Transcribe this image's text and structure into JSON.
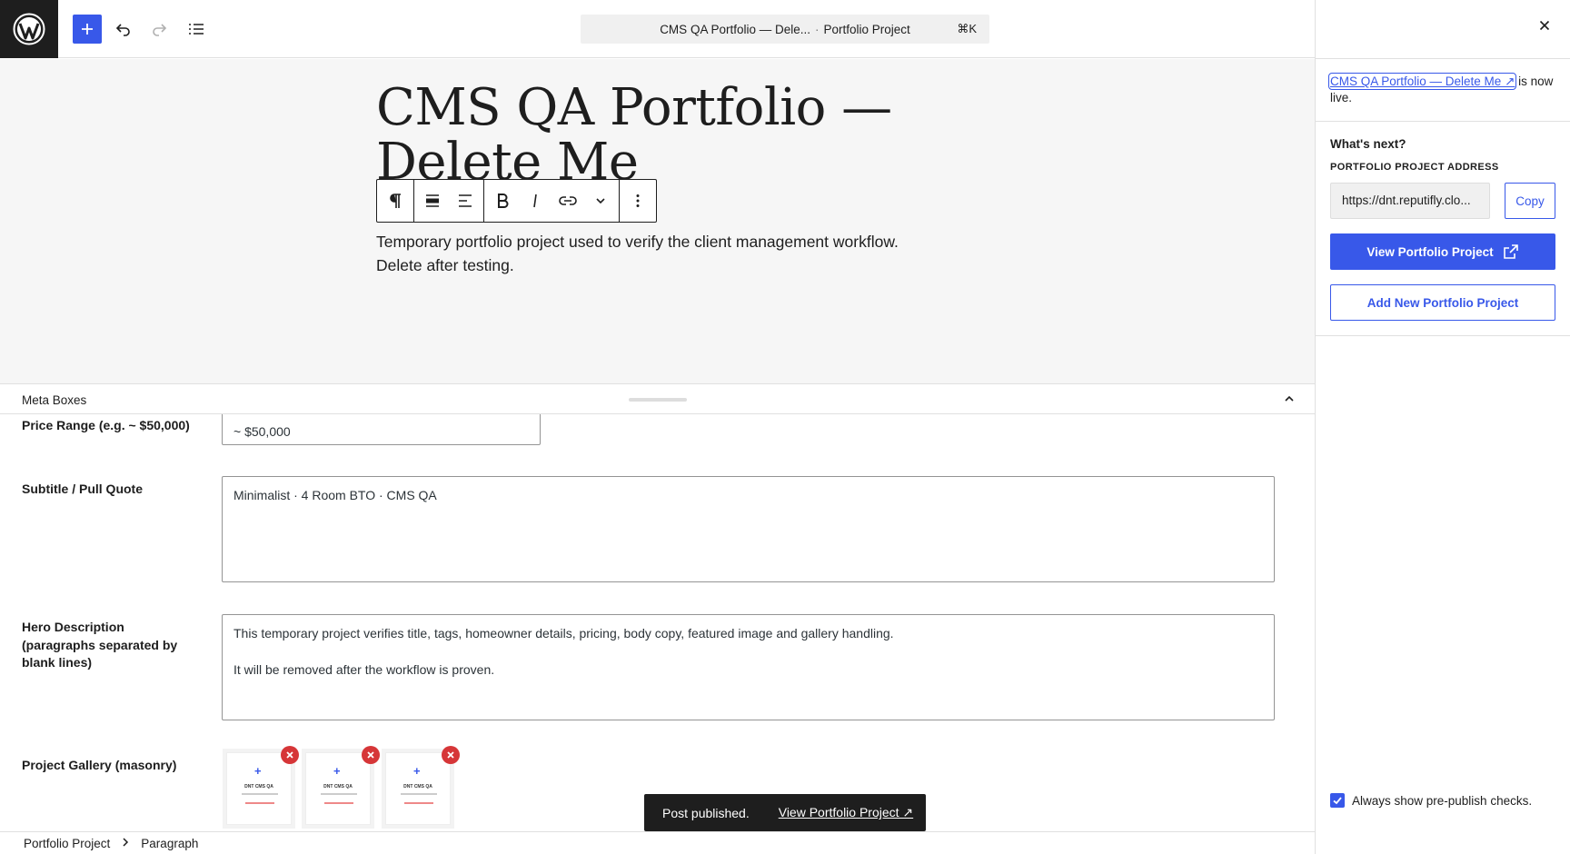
{
  "topbar": {
    "command_title": "CMS QA Portfolio — Dele...",
    "command_separator": "·",
    "command_type": "Portfolio Project",
    "shortcut": "⌘K",
    "icons": [
      "wordpress-logo",
      "plus-icon",
      "undo-icon",
      "redo-icon",
      "document-overview-icon"
    ]
  },
  "editor": {
    "title": "CMS QA Portfolio — Delete Me",
    "paragraph": "Temporary portfolio project used to verify the client management workflow. Delete after testing.",
    "block_toolbar_icons": [
      "paragraph-icon",
      "align-block-icon",
      "align-text-icon",
      "bold-icon",
      "italic-icon",
      "link-icon",
      "more-rich-text-icon",
      "options-icon"
    ]
  },
  "meta_boxes": {
    "title": "Meta Boxes",
    "price_label": "Price Range (e.g. ~ $50,000)",
    "price_value": "~ $50,000",
    "subtitle_label": "Subtitle / Pull Quote",
    "subtitle_value": "Minimalist · 4 Room BTO · CMS QA",
    "hero_label": "Hero Description (paragraphs separated by blank lines)",
    "hero_value_p1": "This temporary project verifies title, tags, homeowner details, pricing, body copy, featured image and gallery handling.",
    "hero_value_p2": "It will be removed after the workflow is proven.",
    "gallery_label": "Project Gallery (masonry)",
    "gallery_thumb_text": "DNT CMS QA"
  },
  "snackbar": {
    "message": "Post published.",
    "link": "View Portfolio Project ↗"
  },
  "footer": {
    "crumbs": [
      "Portfolio Project",
      "Paragraph"
    ]
  },
  "panel": {
    "live_link": "CMS QA Portfolio — Delete Me ↗",
    "live_suffix": " is now live.",
    "whats_next": "What's next?",
    "address_label": "Portfolio Project address",
    "address_value": "https://dnt.reputifly.clo...",
    "copy_label": "Copy",
    "view_label": "View Portfolio Project",
    "add_new_label": "Add New Portfolio Project",
    "always_show": "Always show pre-publish checks."
  },
  "colors": {
    "accent": "#3858e9",
    "danger": "#d63638",
    "dark": "#1e1e1e"
  }
}
